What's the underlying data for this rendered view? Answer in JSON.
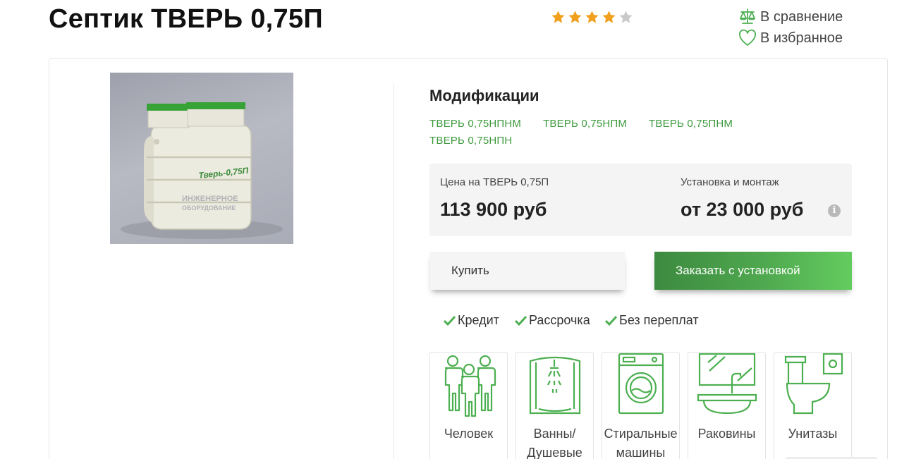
{
  "product": {
    "title": "Септик ТВЕРЬ 0,75П",
    "rating": 4,
    "rating_max": 5
  },
  "actions": {
    "compare_label": "В сравнение",
    "favorite_label": "В избранное"
  },
  "image": {
    "body_text": "Тверь-0,75П",
    "watermark_line1": "ИНЖЕНЕРНОЕ",
    "watermark_line2": "ОБОРУДОВАНИЕ"
  },
  "modifications": {
    "title": "Модификации",
    "items": [
      "ТВЕРЬ 0,75НПНМ",
      "ТВЕРЬ 0,75НПМ",
      "ТВЕРЬ 0,75ПНМ",
      "ТВЕРЬ 0,75НПН"
    ]
  },
  "price": {
    "label": "Цена на ТВЕРЬ 0,75П",
    "value": "113 900 руб",
    "install_label": "Установка и монтаж",
    "install_value": "от 23 000 руб",
    "info_symbol": "i"
  },
  "buttons": {
    "buy": "Купить",
    "order": "Заказать с установкой"
  },
  "perks": [
    "Кредит",
    "Рассрочка",
    "Без переплат"
  ],
  "usage_tiles": [
    {
      "label": "Человек",
      "icon": "people-icon"
    },
    {
      "label": "Ванны/ Душевые",
      "icon": "shower-icon"
    },
    {
      "label": "Стиральные машины",
      "icon": "washing-machine-icon"
    },
    {
      "label": "Раковины",
      "icon": "sink-icon"
    },
    {
      "label": "Унитазы",
      "icon": "toilet-icon"
    }
  ],
  "colors": {
    "accent_green": "#3d9a3d",
    "icon_green": "#4caf50",
    "star": "#f0a01e",
    "button_gradient": [
      "#3c8a3f",
      "#63cc5f"
    ]
  }
}
